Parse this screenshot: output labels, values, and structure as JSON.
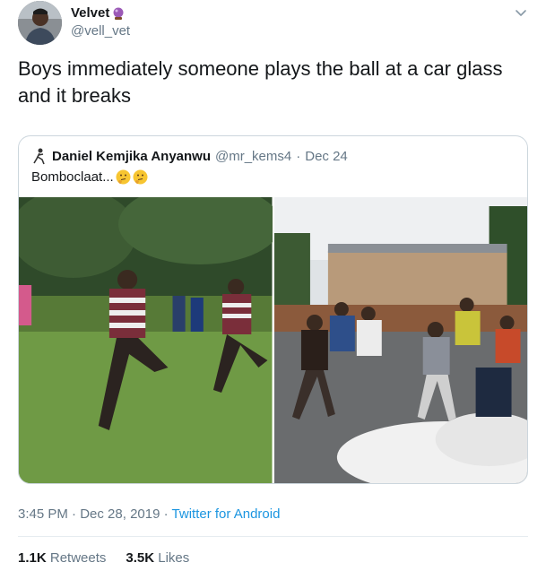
{
  "author": {
    "display_name": "Velvet",
    "handle": "@vell_vet",
    "name_emoji": "crystal-ball-icon"
  },
  "tweet": {
    "text": "Boys immediately someone plays the ball at a car glass and it breaks"
  },
  "quoted": {
    "author_name": "Daniel Kemjika Anyanwu",
    "handle": "@mr_kems4",
    "separator": "·",
    "date": "Dec 24",
    "text": "Bomboclaat...",
    "emojis": [
      "thinking-face-icon",
      "thinking-face-icon"
    ]
  },
  "meta": {
    "time": "3:45 PM",
    "separator1": "·",
    "date": "Dec 28, 2019",
    "separator2": "·",
    "source": "Twitter for Android"
  },
  "stats": {
    "retweets_count": "1.1K",
    "retweets_label": "Retweets",
    "likes_count": "3.5K",
    "likes_label": "Likes"
  },
  "colors": {
    "text": "#14171a",
    "secondary": "#657786",
    "link": "#1b95e0",
    "border": "#ccd6dd"
  }
}
